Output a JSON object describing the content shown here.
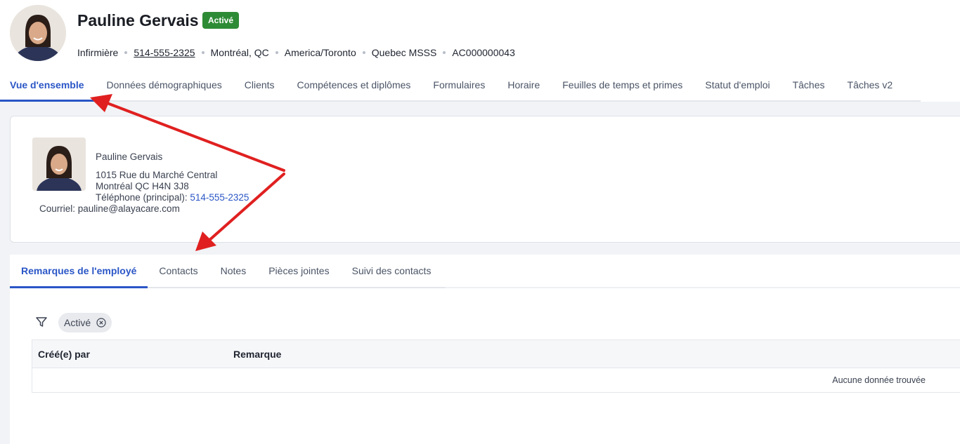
{
  "profile": {
    "name": "Pauline Gervais",
    "status": "Activé",
    "meta": {
      "role": "Infirmière",
      "phone": "514-555-2325",
      "city": "Montréal, QC",
      "timezone": "America/Toronto",
      "region": "Quebec MSSS",
      "employee_id": "AC000000043"
    }
  },
  "tabs": [
    {
      "label": "Vue d'ensemble",
      "active": true
    },
    {
      "label": "Données démographiques"
    },
    {
      "label": "Clients"
    },
    {
      "label": "Compétences et diplômes"
    },
    {
      "label": "Formulaires"
    },
    {
      "label": "Horaire"
    },
    {
      "label": "Feuilles de temps et primes"
    },
    {
      "label": "Statut d'emploi"
    },
    {
      "label": "Tâches"
    },
    {
      "label": "Tâches v2"
    }
  ],
  "card": {
    "name": "Pauline Gervais",
    "address_line1": "1015 Rue du Marché Central",
    "address_line2": "Montréal QC H4N 3J8",
    "phone_label": "Téléphone (principal):",
    "phone": "514-555-2325",
    "email_label": "Courriel:",
    "email": "pauline@alayacare.com"
  },
  "subtabs": [
    {
      "label": "Remarques de l'employé",
      "active": true
    },
    {
      "label": "Contacts"
    },
    {
      "label": "Notes"
    },
    {
      "label": "Pièces jointes"
    },
    {
      "label": "Suivi des contacts"
    }
  ],
  "filter": {
    "chip_label": "Activé"
  },
  "table": {
    "columns": [
      "Créé(e) par",
      "Remarque"
    ],
    "empty_text": "Aucune donnée trouvée"
  },
  "colors": {
    "accent": "#2a56c6",
    "status_active": "#2e8b35",
    "annotation_arrow": "#e02020"
  }
}
